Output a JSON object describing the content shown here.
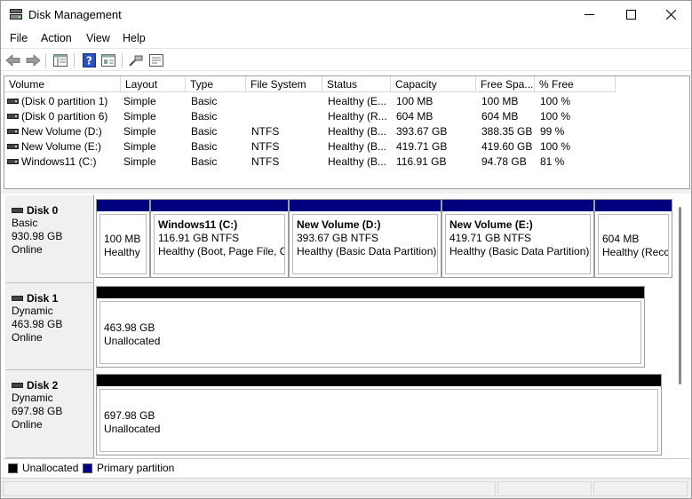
{
  "window": {
    "title": "Disk Management"
  },
  "menu": [
    "File",
    "Action",
    "View",
    "Help"
  ],
  "volume_list": {
    "columns": [
      "Volume",
      "Layout",
      "Type",
      "File System",
      "Status",
      "Capacity",
      "Free Spa...",
      "% Free"
    ],
    "rows": [
      [
        "(Disk 0 partition 1)",
        "Simple",
        "Basic",
        "",
        "Healthy (E...",
        "100 MB",
        "100 MB",
        "100 %"
      ],
      [
        "(Disk 0 partition 6)",
        "Simple",
        "Basic",
        "",
        "Healthy (R...",
        "604 MB",
        "604 MB",
        "100 %"
      ],
      [
        "New Volume (D:)",
        "Simple",
        "Basic",
        "NTFS",
        "Healthy (B...",
        "393.67 GB",
        "388.35 GB",
        "99 %"
      ],
      [
        "New Volume (E:)",
        "Simple",
        "Basic",
        "NTFS",
        "Healthy (B...",
        "419.71 GB",
        "419.60 GB",
        "100 %"
      ],
      [
        "Windows11 (C:)",
        "Simple",
        "Basic",
        "NTFS",
        "Healthy (B...",
        "116.91 GB",
        "94.78 GB",
        "81 %"
      ]
    ]
  },
  "disks": [
    {
      "name": "Disk 0",
      "kind": "Basic",
      "size": "930.98 GB",
      "state": "Online",
      "partitions": [
        {
          "title": "",
          "line1": "100 MB",
          "line2": "Healthy"
        },
        {
          "title": "Windows11  (C:)",
          "line1": "116.91 GB NTFS",
          "line2": "Healthy (Boot, Page File, C"
        },
        {
          "title": "New Volume  (D:)",
          "line1": "393.67 GB NTFS",
          "line2": "Healthy (Basic Data Partition)"
        },
        {
          "title": "New Volume  (E:)",
          "line1": "419.71 GB NTFS",
          "line2": "Healthy (Basic Data Partition)"
        },
        {
          "title": "",
          "line1": "604 MB",
          "line2": "Healthy (Recc"
        }
      ]
    },
    {
      "name": "Disk 1",
      "kind": "Dynamic",
      "size": "463.98 GB",
      "state": "Online",
      "partitions": [
        {
          "line1": "463.98 GB",
          "line2": "Unallocated"
        }
      ]
    },
    {
      "name": "Disk 2",
      "kind": "Dynamic",
      "size": "697.98 GB",
      "state": "Online",
      "partitions": [
        {
          "line1": "697.98 GB",
          "line2": "Unallocated"
        }
      ]
    }
  ],
  "legend": [
    {
      "label": "Unallocated",
      "color": "#000000"
    },
    {
      "label": "Primary partition",
      "color": "#00007f"
    }
  ],
  "colors": {
    "primary": "#00007f",
    "unallocated": "#000000"
  },
  "icons": [
    "back-arrow-icon",
    "forward-arrow-icon",
    "properties-icon",
    "help-icon",
    "show-hide-icon",
    "connect-icon",
    "console-icon"
  ]
}
